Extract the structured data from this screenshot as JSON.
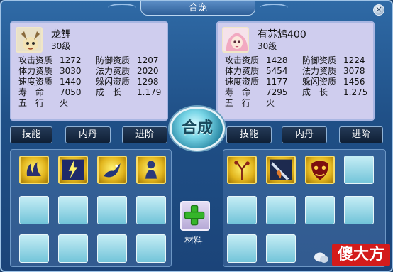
{
  "window": {
    "title": "合宠",
    "close_glyph": "×"
  },
  "left_pet": {
    "name": "龙鲤",
    "level": "30级",
    "stats": [
      [
        "攻击资质",
        "1272",
        "防御资质",
        "1207"
      ],
      [
        "体力资质",
        "3030",
        "法力资质",
        "2020"
      ],
      [
        "速度资质",
        "1440",
        "躲闪资质",
        "1298"
      ],
      [
        "寿　命",
        "7050",
        "成　长",
        "1.179"
      ],
      [
        "五　行",
        "火",
        "",
        ""
      ]
    ],
    "avatar_icon": "dragon-carp-portrait-icon"
  },
  "right_pet": {
    "name": "有苏鸩400",
    "level": "30级",
    "stats": [
      [
        "攻击资质",
        "1428",
        "防御资质",
        "1224"
      ],
      [
        "体力资质",
        "5454",
        "法力资质",
        "3078"
      ],
      [
        "速度资质",
        "1177",
        "躲闪资质",
        "1456"
      ],
      [
        "寿　命",
        "7295",
        "成　长",
        "1.275"
      ],
      [
        "五　行",
        "火",
        "",
        ""
      ]
    ],
    "avatar_icon": "fox-maiden-portrait-icon"
  },
  "buttons": {
    "combine": "合成",
    "left_skills": "技能",
    "left_inner_pill": "内丹",
    "left_advance": "进阶",
    "right_skills": "技能",
    "right_inner_pill": "内丹",
    "right_advance": "进阶",
    "material": "材料"
  },
  "left_skill_icons": [
    "water-wave-icon",
    "lightning-strike-icon",
    "beast-leap-icon",
    "spirit-figure-icon"
  ],
  "right_skill_icons": [
    "tree-branch-icon",
    "blade-slash-icon",
    "demon-mask-icon"
  ],
  "watermark": {
    "text": "傻大方"
  },
  "colors": {
    "accent": "#2f6aa6",
    "card_bg": "#cfcdee",
    "slot": "#8fd3e3",
    "skill_gold": "#e2b51d"
  }
}
